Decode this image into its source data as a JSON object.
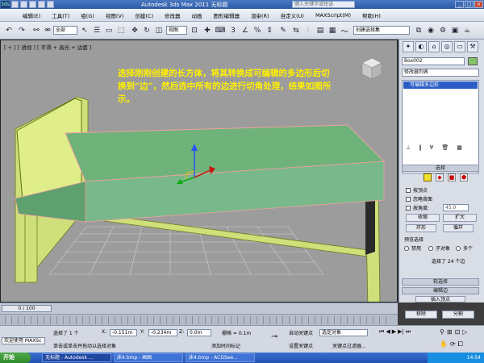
{
  "app": {
    "title": "Autodesk 3ds Max  2011     无标题",
    "search_placeholder": "键入关键字或短语",
    "logo": "3ds"
  },
  "menu": [
    "编辑(E)",
    "工具(T)",
    "组(G)",
    "视图(V)",
    "创建(C)",
    "修改器",
    "动画",
    "图形编辑器",
    "渲染(R)",
    "自定义(U)",
    "MAXScript(M)",
    "帮助(H)"
  ],
  "toolbar": {
    "selection_filter": "全部",
    "coord_system": "视图",
    "named_selection": "创建选择集",
    "snap_value": "3"
  },
  "viewport": {
    "label": "[ + ] [ 透视 ] [ 平滑 + 高光 + 边面 ]",
    "caption": "选择刚刚创建的长方体，将其转换成可编辑的多边形后切换到“边”，然后选中所有的边进行切角处理，结果如图所示。"
  },
  "command_panel": {
    "object_name": "Box002",
    "object_color": "#85c46a",
    "modifier_list": "修改器列表",
    "stack_item": "可编辑多边形",
    "selection_header": "选择",
    "by_vertex": "按顶点",
    "ignore_backfacing": "忽略背面",
    "by_angle": "按角度:",
    "angle_value": "45.0",
    "shrink": "收缩",
    "grow": "扩大",
    "ring": "环形",
    "loop": "循环",
    "preview_header": "预览选择",
    "preview_off": "禁用",
    "preview_subobj": "子对象",
    "preview_multi": "多个",
    "selected_status": "选择了 24 个边",
    "soft_select_header": "软选择",
    "edit_edges_header": "编辑边",
    "insert_vertex": "插入顶点",
    "remove": "移除",
    "split": "分割"
  },
  "timeline": {
    "frame_display": "0 / 100"
  },
  "status": {
    "selection_count": "选择了 1 个",
    "x_label": "X:",
    "x_value": "-0.151m",
    "y_label": "Y:",
    "y_value": "-0.234m",
    "z_label": "Z:",
    "z_value": "0.0m",
    "grid": "栅格 = 0.1m",
    "autokey": "自动关键点",
    "selected_object": "选定对象",
    "setkey": "设置关键点",
    "key_filter": "关键点过滤器...",
    "prompt": "单击或单击并拖动以选择对象",
    "add_time_tag": "添加时间标记",
    "welcome": "欢迎使用 MAXSc"
  },
  "taskbar": {
    "start": "开始",
    "tasks": [
      "无标题 - Autodesk ...",
      "床4.bmp - 画图",
      "床4.bmp - ACDSee..."
    ],
    "clock": "14:54"
  }
}
